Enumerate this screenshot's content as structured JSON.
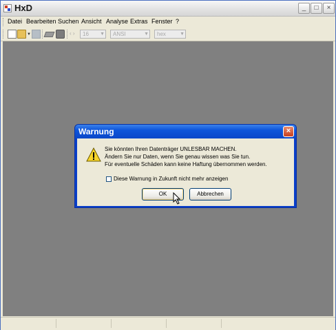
{
  "window": {
    "title": "HxD",
    "controls": {
      "minimize": "_",
      "maximize": "□",
      "close": "×"
    }
  },
  "menu": {
    "items": [
      "Datei",
      "Bearbeiten",
      "Suchen",
      "Ansicht",
      "Analyse",
      "Extras",
      "Fenster",
      "?"
    ]
  },
  "toolbar": {
    "icons": [
      "new-file-icon",
      "open-folder-icon",
      "save-icon",
      "eraser-icon",
      "disk-icon"
    ],
    "bytes_per_row": "16",
    "charset": "ANSI",
    "offset_base": "hex",
    "arrows": "‹ ›"
  },
  "dialog": {
    "title": "Warnung",
    "close_glyph": "×",
    "icon": "warning-icon",
    "message_lines": [
      "Sie könnten Ihren Datenträger UNLESBAR MACHEN.",
      "Ändern Sie nur Daten, wenn Sie genau wissen was Sie tun.",
      "Für eventuelle Schäden kann keine Haftung übernommen werden."
    ],
    "checkbox_label": "Diese Warnung in Zukunft nicht mehr anzeigen",
    "checkbox_checked": false,
    "ok_label": "OK",
    "cancel_label": "Abbrechen"
  },
  "colors": {
    "workspace": "#808080",
    "dialog_title": "#0a47c9",
    "chrome": "#ece9d8"
  }
}
